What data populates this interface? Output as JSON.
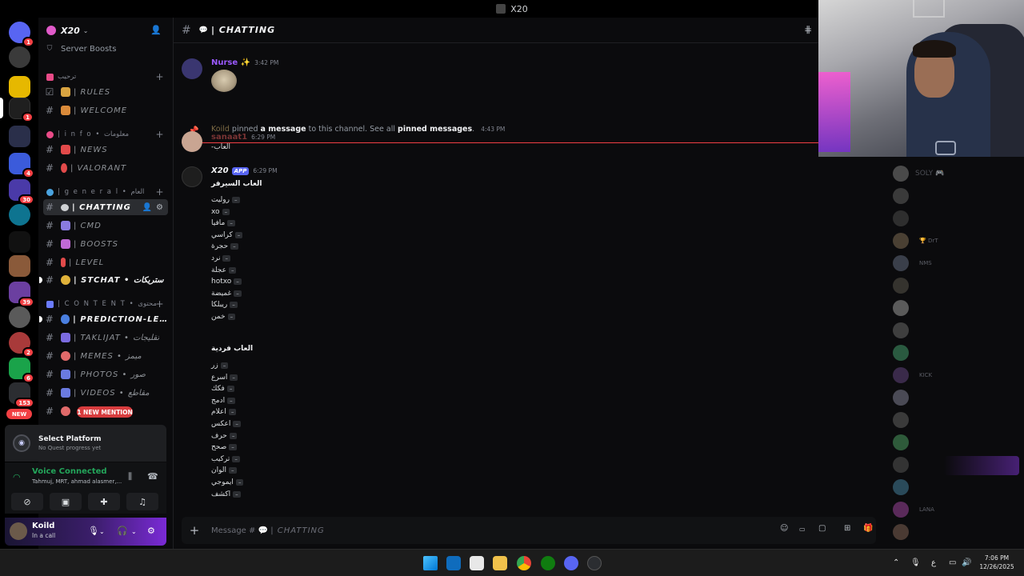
{
  "window": {
    "title": "X20"
  },
  "guild": {
    "name": "X20"
  },
  "sidebar": {
    "boosts_label": "Server Boosts",
    "categories": [
      {
        "label": "ترحيب",
        "emoji_color": "#e94b88"
      },
      {
        "label": "| i n f o • معلومات",
        "emoji_color": "#e94b88"
      },
      {
        "label": "| g e n e r a l • العام",
        "emoji_color": "#4aa3df"
      },
      {
        "label": "| C O N T E N T • محتوى",
        "emoji_color": "#6b7cff"
      }
    ],
    "channels": [
      {
        "label": "| RULES",
        "emoji_color": "#d9a441"
      },
      {
        "label": "| WELCOME",
        "emoji_color": "#d98a3a"
      },
      {
        "label": "| NEWS",
        "emoji_color": "#e24a4a"
      },
      {
        "label": "| VALORANT",
        "emoji_color": "#e24a4a"
      },
      {
        "label": "| CHATTING",
        "emoji_color": "#cfd1d4"
      },
      {
        "label": "| CMD",
        "emoji_color": "#8a7be0"
      },
      {
        "label": "| BOOSTS",
        "emoji_color": "#c06ad6"
      },
      {
        "label": "| LEVEL",
        "emoji_color": "#e24a4a"
      },
      {
        "label": "| STCHAT • ستريكات",
        "emoji_color": "#e0b23a"
      },
      {
        "label": "| PREDICTION-LE...",
        "emoji_color": "#4a7fe0"
      },
      {
        "label": "| TAKLIJAT • تقليجات",
        "emoji_color": "#7b6be0"
      },
      {
        "label": "| MEMES • ميمز",
        "emoji_color": "#e06a6a"
      },
      {
        "label": "| PHOTOS • صور",
        "emoji_color": "#6a7ae0"
      },
      {
        "label": "| VIDEOS • مقاطع",
        "emoji_color": "#6a7ae0"
      }
    ],
    "new_mention": "1 NEW MENTION"
  },
  "rail": {
    "new_label": "NEW",
    "badges": [
      "1",
      "1",
      "4",
      "30",
      "39",
      "2",
      "6",
      "153"
    ]
  },
  "quest": {
    "title": "Select Platform",
    "subtitle": "No Quest progress yet"
  },
  "voice": {
    "title": "Voice Connected",
    "subtitle": "Tahmuj, MRT, ahmad alasmer,..."
  },
  "user": {
    "name": "Koild",
    "status": "In a call"
  },
  "channel": {
    "name": "| CHATTING"
  },
  "messages": {
    "m1": {
      "author": "Nurse",
      "time": "3:42 PM",
      "color": "#9b59ff"
    },
    "sys": {
      "actor": "Koild",
      "pinned": "pinned",
      "a_message": "a message",
      "to_channel": "to this channel. See all",
      "pinned_messages": "pinned messages",
      "end": ".",
      "time": "4:43 PM"
    },
    "m2": {
      "author": "sanaat1",
      "time": "6:29 PM",
      "text": "-العاب",
      "color": "#7a3434"
    },
    "m3": {
      "author": "X20",
      "badge": "APP",
      "time": "6:29 PM",
      "heading1": "العاب السيرفر",
      "list1": [
        "روليت",
        "xo",
        "مافيا",
        "كراسي",
        "حجرة",
        "نرد",
        "عجلة",
        "hotxo",
        "غميضة",
        "ريبلكا",
        "خمن"
      ],
      "heading2": "العاب فردية",
      "list2": [
        "زر",
        "اسرع",
        "فكك",
        "ادمج",
        "اعلام",
        "اعكس",
        "حرف",
        "صحح",
        "تركيب",
        "الوان",
        "ايموجي",
        "اكشف"
      ],
      "dash": "–"
    }
  },
  "composer": {
    "placeholder_prefix": "Message #",
    "placeholder_channel": "| CHATTING"
  },
  "members": [
    {
      "name": "SOLY 🎮",
      "tag": ""
    },
    {
      "name": "",
      "tag": ""
    },
    {
      "name": "",
      "tag": ""
    },
    {
      "name": "",
      "tag": "🏆 DrT"
    },
    {
      "name": "",
      "tag": "NMS"
    },
    {
      "name": "",
      "tag": ""
    },
    {
      "name": "",
      "tag": ""
    },
    {
      "name": "",
      "tag": ""
    },
    {
      "name": "",
      "tag": ""
    },
    {
      "name": "",
      "tag": "KICK"
    },
    {
      "name": "",
      "tag": ""
    },
    {
      "name": "",
      "tag": ""
    },
    {
      "name": "",
      "tag": ""
    },
    {
      "name": "",
      "tag": ""
    },
    {
      "name": "",
      "tag": ""
    },
    {
      "name": "",
      "tag": "LANA"
    },
    {
      "name": "",
      "tag": ""
    }
  ],
  "clock": {
    "time": "7:06 PM",
    "date": "12/26/2025"
  },
  "taskbar": {
    "lang": "ع"
  }
}
